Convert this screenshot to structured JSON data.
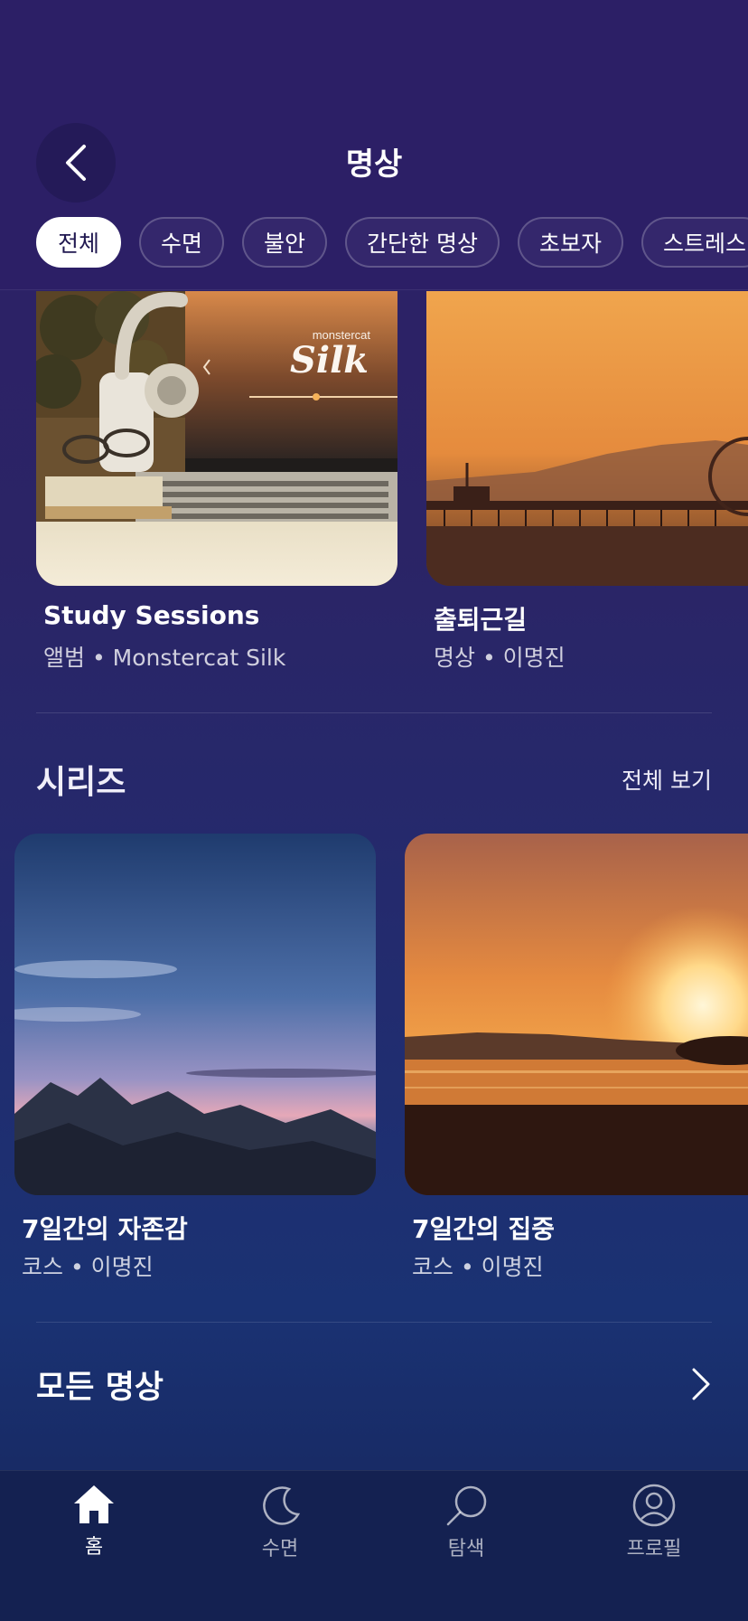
{
  "header": {
    "title": "명상",
    "chips": [
      "전체",
      "수면",
      "불안",
      "간단한 명상",
      "초보자",
      "스트레스"
    ]
  },
  "featured": [
    {
      "title": "Study Sessions",
      "subtitle": "앨범 • Monstercat Silk",
      "art_brand": "monstercat",
      "art_name": "Silk"
    },
    {
      "title": "출퇴근길",
      "subtitle": "명상 • 이명진"
    }
  ],
  "series": {
    "title": "시리즈",
    "see_all": "전체 보기",
    "items": [
      {
        "title": "7일간의 자존감",
        "subtitle": "코스 • 이명진"
      },
      {
        "title": "7일간의 집중",
        "subtitle": "코스 • 이명진"
      }
    ]
  },
  "all_meditations": {
    "label": "모든 명상"
  },
  "tabbar": {
    "tabs": [
      {
        "label": "홈",
        "icon": "home-icon",
        "active": true
      },
      {
        "label": "수면",
        "icon": "moon-icon",
        "active": false
      },
      {
        "label": "탐색",
        "icon": "search-icon",
        "active": false
      },
      {
        "label": "프로필",
        "icon": "profile-icon",
        "active": false
      }
    ]
  }
}
